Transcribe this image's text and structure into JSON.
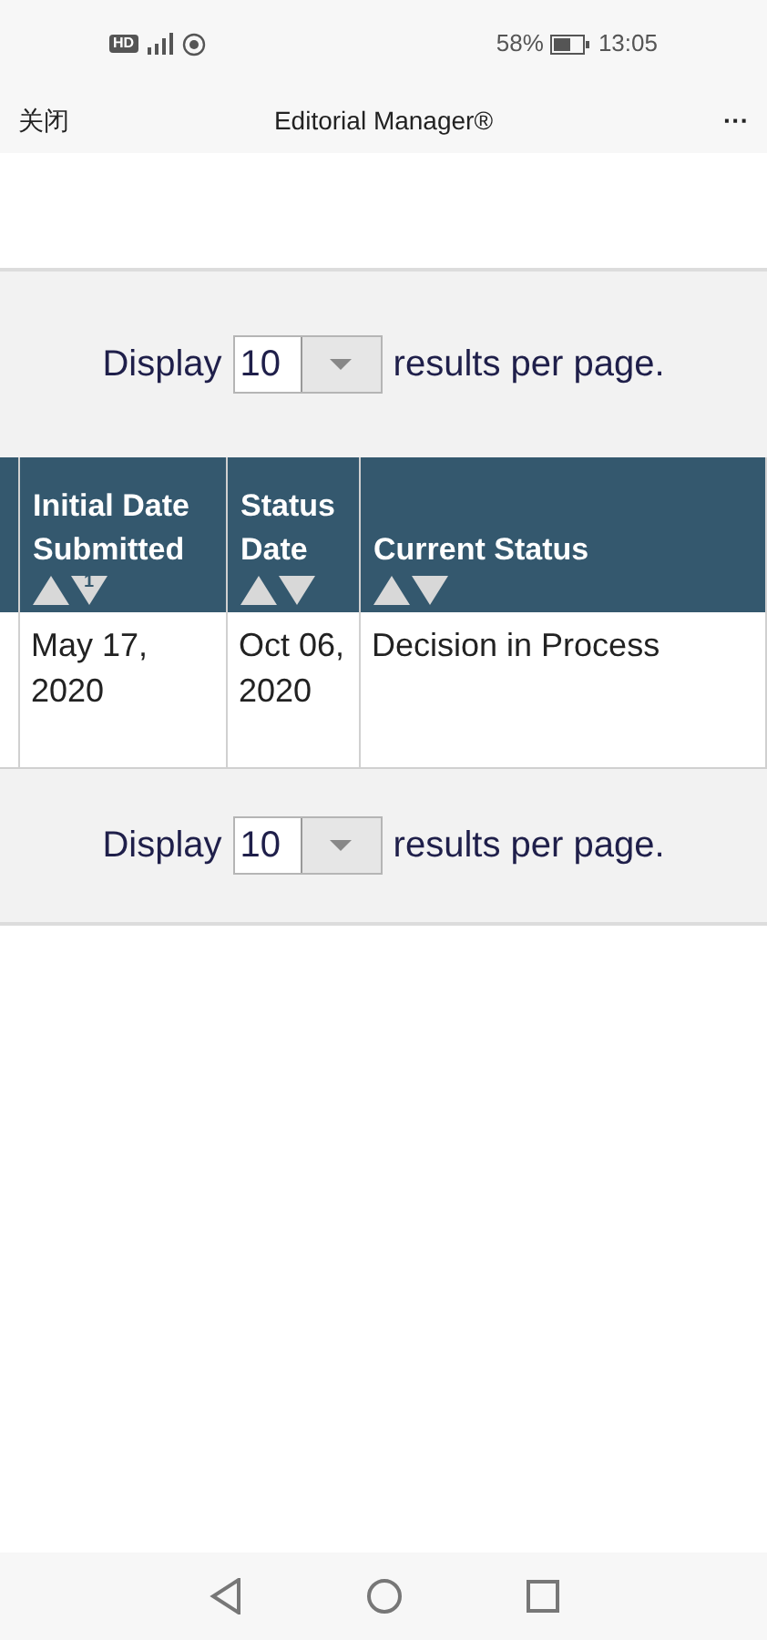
{
  "status_bar": {
    "badge": "HD",
    "battery_percent": "58%",
    "time": "13:05"
  },
  "title_bar": {
    "close": "关闭",
    "title": "Editorial Manager®",
    "more": "···"
  },
  "top_pager": {
    "label": "Display",
    "value": "10",
    "suffix": "results per page."
  },
  "table": {
    "columns": [
      {
        "label": "Initial Date Submitted",
        "sort_rank": "1"
      },
      {
        "label": "Status Date"
      },
      {
        "label": "Current Status"
      }
    ],
    "rows": [
      {
        "cells": [
          "May 17, 2020",
          "Oct 06, 2020",
          "Decision in Process"
        ]
      }
    ]
  },
  "bottom_pager": {
    "label": "Display",
    "value": "10",
    "suffix": "results per page."
  }
}
